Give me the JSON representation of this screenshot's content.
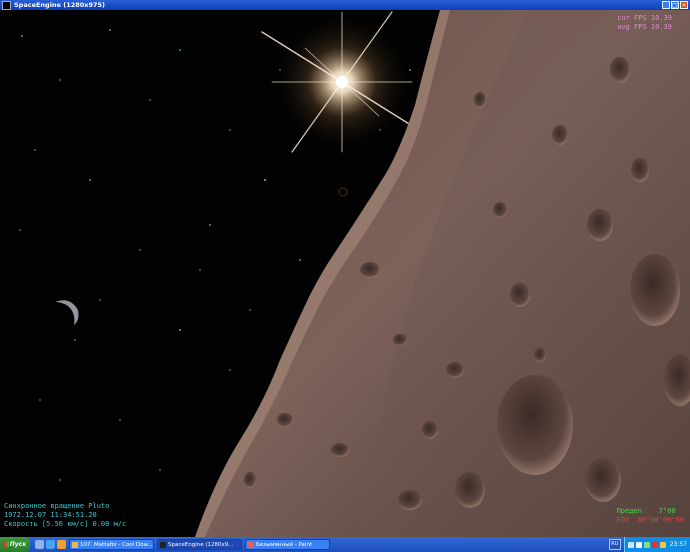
{
  "window": {
    "title": "SpaceEngine (1280x975)",
    "controls": [
      "_",
      "□",
      "×"
    ]
  },
  "hud": {
    "cur_fps": "cur FPS 10.39",
    "avg_fps": "avg FPS 10.39",
    "mode": "Синхронное вращение Pluto",
    "date": "1972.12.07 11:34:51.20",
    "speed": "Скорость [5.56 км/с] 0.00 м/с",
    "limit": "Предел    7°00",
    "fov": "FOV  60°00'00\"00"
  },
  "taskbar": {
    "start_label": "Пуск",
    "quick_launch": [
      {
        "icon": "show-desktop-icon",
        "color": "#8fb3e8"
      },
      {
        "icon": "internet-explorer-icon",
        "color": "#4aa3f0"
      },
      {
        "icon": "media-player-icon",
        "color": "#f0a030"
      }
    ],
    "tasks": [
      {
        "label": "107. Mattafix - Cool Dow...",
        "icon": "winamp-icon",
        "icon_color": "#e9b84a",
        "active": false
      },
      {
        "label": "SpaceEngine (1280x9...",
        "icon": "spaceengine-icon",
        "icon_color": "#222222",
        "active": true
      },
      {
        "label": "Безымянный - Paint",
        "icon": "paint-icon",
        "icon_color": "#e85c5c",
        "active": false
      }
    ],
    "language": "RU",
    "tray_icons": [
      {
        "icon": "chevron-icon",
        "color": "#cfe7ff"
      },
      {
        "icon": "speaker-icon",
        "color": "#f3f3f3"
      },
      {
        "icon": "network-icon",
        "color": "#7de07d"
      },
      {
        "icon": "antivirus-icon",
        "color": "#e33333"
      },
      {
        "icon": "shield-icon",
        "color": "#f3c542"
      }
    ],
    "clock": "23:57"
  }
}
